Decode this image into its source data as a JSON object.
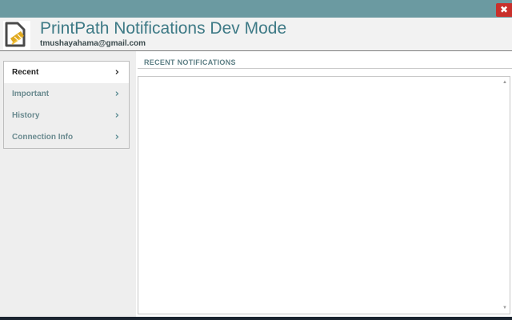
{
  "window": {
    "close_glyph": "✖",
    "close_icon": "close-icon",
    "titlebar_color": "#6b9aa1"
  },
  "header": {
    "title": "PrintPath Notifications Dev Mode",
    "user_email": "tmushayahama@gmail.com",
    "logo_icon": "printpath-logo-icon",
    "title_color": "#3e7a86"
  },
  "sidebar": {
    "items": [
      {
        "label": "Recent",
        "active": true,
        "icon": "chevron-right-icon"
      },
      {
        "label": "Important",
        "active": false,
        "icon": "chevron-right-icon"
      },
      {
        "label": "History",
        "active": false,
        "icon": "chevron-right-icon"
      },
      {
        "label": "Connection Info",
        "active": false,
        "icon": "chevron-right-icon"
      }
    ]
  },
  "main": {
    "section_title": "RECENT NOTIFICATIONS",
    "notifications": []
  },
  "scrollbar": {
    "up_glyph": "▲",
    "down_glyph": "▼"
  }
}
